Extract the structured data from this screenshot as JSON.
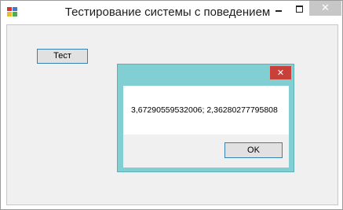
{
  "window": {
    "title": "Тестирование системы с поведением",
    "controls": {
      "minimize_icon": "minimize-icon",
      "maximize_icon": "maximize-icon",
      "close_icon": "close-icon",
      "close_glyph": "✕"
    }
  },
  "main": {
    "test_button_label": "Тест"
  },
  "dialog": {
    "message": "3,67290559532006; 2,36280277795808",
    "ok_label": "OK",
    "close_glyph": "✕"
  },
  "colors": {
    "dialog_frame": "#82cfd3",
    "dialog_close": "#c7403a",
    "window_close": "#c7c7c7",
    "button_border": "#3c7fb1"
  }
}
